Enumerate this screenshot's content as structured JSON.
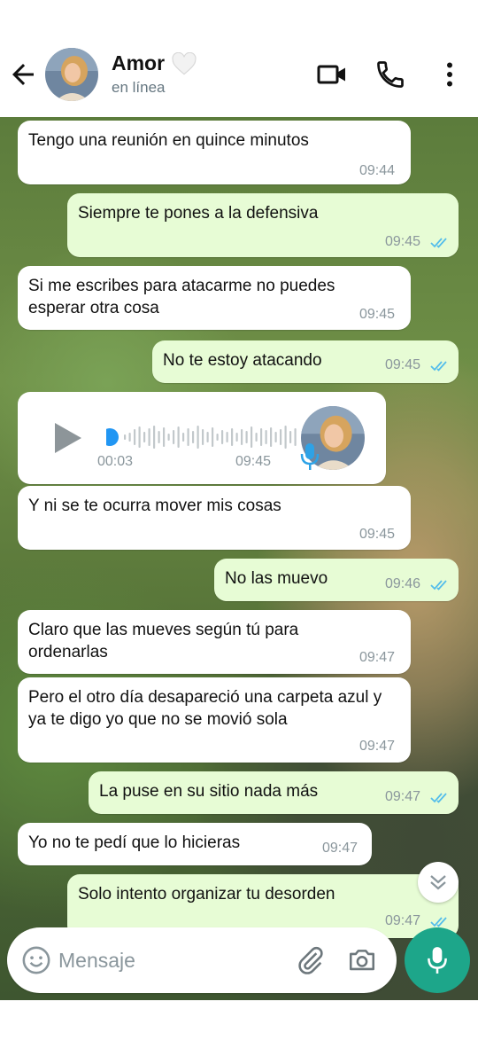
{
  "header": {
    "contact_name": "Amor",
    "status": "en línea",
    "icons": {
      "back": "arrow-left-icon",
      "video": "video-call-icon",
      "call": "phone-icon",
      "menu": "more-vert-icon",
      "heart": "white-heart-icon"
    }
  },
  "messages": [
    {
      "dir": "in",
      "text": "Tengo una reunión en quince minutos",
      "time": "09:44"
    },
    {
      "dir": "out",
      "text": "Siempre te pones a la defensiva",
      "time": "09:45",
      "read": true
    },
    {
      "dir": "in",
      "text": "Si me escribes para atacarme no puedes esperar otra cosa",
      "time": "09:45"
    },
    {
      "dir": "out",
      "text": "No te estoy atacando",
      "time": "09:45",
      "read": true
    },
    {
      "dir": "in",
      "type": "voice",
      "duration": "00:03",
      "time": "09:45",
      "progress": 0
    },
    {
      "dir": "in",
      "text": "Y ni se te ocurra mover mis cosas",
      "time": "09:45"
    },
    {
      "dir": "out",
      "text": "No las muevo",
      "time": "09:46",
      "read": true
    },
    {
      "dir": "in",
      "text": "Claro que las mueves según tú para ordenarlas",
      "time": "09:47"
    },
    {
      "dir": "in",
      "text": "Pero el otro día desapareció una carpeta azul y ya te digo yo que no se movió sola",
      "time": "09:47"
    },
    {
      "dir": "out",
      "text": "La puse en su sitio nada más",
      "time": "09:47",
      "read": true
    },
    {
      "dir": "in",
      "text": "Yo no te pedí que lo hicieras",
      "time": "09:47"
    },
    {
      "dir": "out",
      "text": "Solo intento organizar tu desorden",
      "time": "09:47",
      "read": true
    }
  ],
  "input": {
    "placeholder": "Mensaje",
    "icons": {
      "emoji": "emoji-icon",
      "attach": "paperclip-icon",
      "camera": "camera-icon",
      "mic": "microphone-icon"
    }
  },
  "colors": {
    "incoming_bubble": "#ffffff",
    "outgoing_bubble": "#e7fcd5",
    "read_ticks": "#53bdeb",
    "accent": "#1da68a",
    "voice_dot": "#2196f3"
  }
}
